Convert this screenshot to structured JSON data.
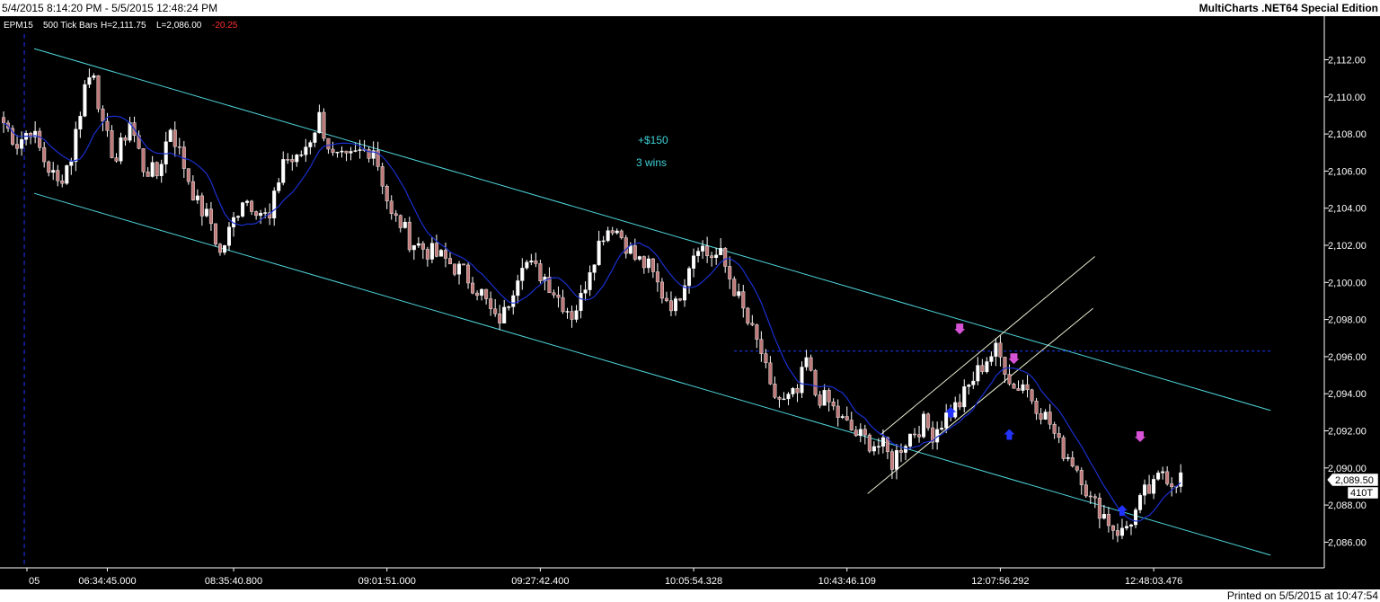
{
  "window": {
    "date_range": "5/4/2015 8:14:20 PM - 5/5/2015 12:48:24 PM",
    "app_name": "MultiCharts .NET64 Special Edition",
    "printed": "Printed on 5/5/2015 at 10:47:54"
  },
  "colors": {
    "background": "#000000",
    "channel": "#4fd6dc",
    "moving_average": "#1a2fd0",
    "candle_up": "#ffffff",
    "candle_down": "#c07a7a",
    "wick": "#ffffff",
    "short_arrow": "#d552d5",
    "long_arrow": "#2233ff",
    "pnl_text": "#3fd0d6",
    "subchannel": "#e7ebcf",
    "dotted_level": "#1f3cff"
  },
  "chart_data": {
    "type": "candlestick",
    "symbol": "EPM15",
    "bar_type": "500 Tick Bars",
    "high_label": "H=2,111.75",
    "low_label": "L=2,086.00",
    "change_label": "-20.25",
    "current_price": "2,089.50",
    "tick_count": "410T",
    "ylim": [
      2085,
      2113
    ],
    "y_ticks": [
      "2,112.00",
      "2,110.00",
      "2,108.00",
      "2,106.00",
      "2,104.00",
      "2,102.00",
      "2,100.00",
      "2,098.00",
      "2,096.00",
      "2,094.00",
      "2,092.00",
      "2,090.00",
      "2,088.00",
      "2,086.00"
    ],
    "y_tick_values": [
      2112,
      2110,
      2108,
      2106,
      2104,
      2102,
      2100,
      2098,
      2096,
      2094,
      2092,
      2090,
      2088,
      2086
    ],
    "x_ticks": [
      "05",
      "06:34:45.000",
      "08:35:40.800",
      "09:01:51.000",
      "09:27:42.400",
      "10:05:54.328",
      "10:43:46.109",
      "12:07:56.292",
      "12:48:03.476"
    ],
    "x_tick_bar_index": [
      0,
      23,
      51,
      85,
      119,
      153,
      187,
      221,
      255
    ],
    "bar_count": 262,
    "keypoints": [
      [
        0,
        2108.6
      ],
      [
        3,
        2107.5
      ],
      [
        6,
        2108.3
      ],
      [
        9,
        2106.6
      ],
      [
        12,
        2105.3
      ],
      [
        15,
        2106.8
      ],
      [
        18,
        2110.6
      ],
      [
        20,
        2111.5
      ],
      [
        22,
        2108.2
      ],
      [
        25,
        2106.6
      ],
      [
        28,
        2108.7
      ],
      [
        31,
        2106.2
      ],
      [
        34,
        2105.8
      ],
      [
        37,
        2108.4
      ],
      [
        40,
        2106.3
      ],
      [
        43,
        2104.2
      ],
      [
        46,
        2103.2
      ],
      [
        48,
        2101.5
      ],
      [
        50,
        2102.7
      ],
      [
        53,
        2104.6
      ],
      [
        56,
        2104.1
      ],
      [
        59,
        2103.3
      ],
      [
        62,
        2106.7
      ],
      [
        65,
        2106.5
      ],
      [
        68,
        2107.8
      ],
      [
        70,
        2108.9
      ],
      [
        73,
        2106.7
      ],
      [
        76,
        2106.5
      ],
      [
        79,
        2107.0
      ],
      [
        82,
        2107.3
      ],
      [
        84,
        2105.5
      ],
      [
        86,
        2103.5
      ],
      [
        88,
        2103.2
      ],
      [
        90,
        2102.3
      ],
      [
        94,
        2101.7
      ],
      [
        98,
        2101.2
      ],
      [
        102,
        2100.5
      ],
      [
        106,
        2099.4
      ],
      [
        109,
        2097.9
      ],
      [
        111,
        2098.3
      ],
      [
        113,
        2099.8
      ],
      [
        115,
        2101.3
      ],
      [
        117,
        2100.8
      ],
      [
        120,
        2100.3
      ],
      [
        123,
        2099.2
      ],
      [
        126,
        2098.3
      ],
      [
        128,
        2099.1
      ],
      [
        130,
        2100.9
      ],
      [
        133,
        2102.7
      ],
      [
        135,
        2103.1
      ],
      [
        137,
        2102.5
      ],
      [
        140,
        2101.3
      ],
      [
        143,
        2100.8
      ],
      [
        146,
        2099.4
      ],
      [
        149,
        2098.7
      ],
      [
        152,
        2101.1
      ],
      [
        154,
        2102.2
      ],
      [
        156,
        2101.5
      ],
      [
        159,
        2101.4
      ],
      [
        162,
        2099.7
      ],
      [
        165,
        2097.8
      ],
      [
        168,
        2096.2
      ],
      [
        170,
        2094.1
      ],
      [
        173,
        2093.5
      ],
      [
        176,
        2094.0
      ],
      [
        178,
        2095.8
      ],
      [
        180,
        2094.0
      ],
      [
        183,
        2093.5
      ],
      [
        186,
        2092.5
      ],
      [
        189,
        2091.8
      ],
      [
        192,
        2091.4
      ],
      [
        195,
        2091.1
      ],
      [
        197,
        2090.3
      ],
      [
        199,
        2091.2
      ],
      [
        201,
        2091.8
      ],
      [
        204,
        2092.4
      ],
      [
        206,
        2091.9
      ],
      [
        209,
        2092.8
      ],
      [
        212,
        2093.5
      ],
      [
        215,
        2094.8
      ],
      [
        218,
        2095.9
      ],
      [
        220,
        2096.3
      ],
      [
        222,
        2095.5
      ],
      [
        224,
        2094.3
      ],
      [
        226,
        2094.6
      ],
      [
        228,
        2093.8
      ],
      [
        230,
        2093.1
      ],
      [
        232,
        2092.4
      ],
      [
        234,
        2091.2
      ],
      [
        237,
        2090.4
      ],
      [
        239,
        2089.6
      ],
      [
        241,
        2088.2
      ],
      [
        243,
        2087.8
      ],
      [
        246,
        2086.8
      ],
      [
        248,
        2086.5
      ],
      [
        251,
        2087.6
      ],
      [
        253,
        2088.6
      ],
      [
        255,
        2088.9
      ],
      [
        257,
        2089.9
      ],
      [
        259,
        2089.3
      ],
      [
        261,
        2089.5
      ]
    ],
    "bar_high": 2111.75,
    "bar_low": 2086.0,
    "annotations": {
      "pnl": "+$150",
      "wins": "3 wins"
    },
    "channel_upper": [
      [
        2,
        2112.6
      ],
      [
        259,
        2093.1
      ]
    ],
    "channel_lower": [
      [
        2,
        2104.8
      ],
      [
        259,
        2085.3
      ]
    ],
    "subchannel_upper": [
      [
        188,
        2091.2
      ],
      [
        232,
        2101.2
      ]
    ],
    "subchannel_lower": [
      [
        186,
        2089.1
      ],
      [
        232,
        2098.8
      ]
    ],
    "dotted_level": {
      "value": 2096.3,
      "from_bar": 156,
      "to_bar": 262
    },
    "short_signals": [
      {
        "bar": 210,
        "price": 2097.1
      },
      {
        "bar": 222,
        "price": 2095.5
      },
      {
        "bar": 250,
        "price": 2091.3
      }
    ],
    "long_signals": [
      {
        "bar": 208,
        "price": 2093.2
      },
      {
        "bar": 221,
        "price": 2092.0
      },
      {
        "bar": 246,
        "price": 2087.9
      }
    ],
    "vertical_marker_bar": 1
  }
}
